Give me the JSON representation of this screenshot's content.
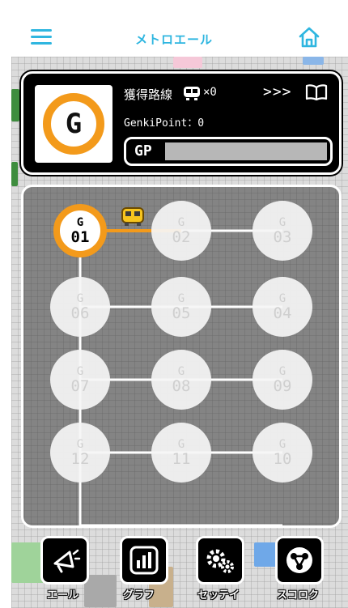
{
  "header": {
    "title": "メトロエール",
    "menu_icon": "hamburger-menu-icon",
    "home_icon": "home-icon"
  },
  "status": {
    "station_letter": "G",
    "owned_label": "獲得路線",
    "owned_count": "×0",
    "more_label": ">>>",
    "genki_point_label": "GenkiPoint：0",
    "gp_bar_label": "GP",
    "gp_fraction": 0.0
  },
  "board": {
    "line": "G",
    "active_station": "01",
    "nodes": [
      {
        "line": "G",
        "num": "01",
        "active": true
      },
      {
        "line": "G",
        "num": "02",
        "active": false
      },
      {
        "line": "G",
        "num": "03",
        "active": false
      },
      {
        "line": "G",
        "num": "06",
        "active": false
      },
      {
        "line": "G",
        "num": "05",
        "active": false
      },
      {
        "line": "G",
        "num": "04",
        "active": false
      },
      {
        "line": "G",
        "num": "07",
        "active": false
      },
      {
        "line": "G",
        "num": "08",
        "active": false
      },
      {
        "line": "G",
        "num": "09",
        "active": false
      },
      {
        "line": "G",
        "num": "12",
        "active": false
      },
      {
        "line": "G",
        "num": "11",
        "active": false
      },
      {
        "line": "G",
        "num": "10",
        "active": false
      }
    ]
  },
  "nav": {
    "items": [
      {
        "label": "エール",
        "icon": "megaphone-icon"
      },
      {
        "label": "グラフ",
        "icon": "bar-chart-icon"
      },
      {
        "label": "セッテイ",
        "icon": "settings-gears-icon"
      },
      {
        "label": "スコロク",
        "icon": "share-nodes-icon"
      }
    ]
  },
  "colors": {
    "accent": "#2fb6e0",
    "ginza_orange": "#f39a1b",
    "panel_bg": "#000000"
  }
}
